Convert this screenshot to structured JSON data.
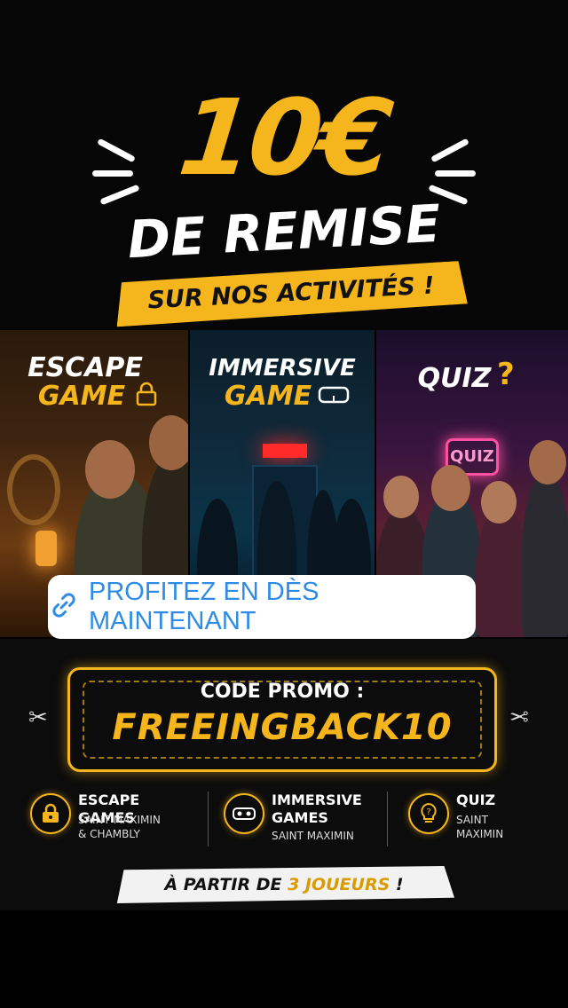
{
  "header": {
    "amount": "10€",
    "headline": "DE REMISE",
    "subline": "SUR NOS ACTIVITÉS !"
  },
  "panels": [
    {
      "line1": "ESCAPE",
      "line2": "GAME",
      "icon": "lock-icon"
    },
    {
      "line1": "IMMERSIVE",
      "line2": "GAME",
      "icon": "vr-headset-icon"
    },
    {
      "title": "QUIZ",
      "icon": "question-mark-icon",
      "sign": "QUIZ"
    }
  ],
  "cta": {
    "label": "PROFITEZ EN DÈS MAINTENANT",
    "icon": "link-icon"
  },
  "promo": {
    "label": "CODE PROMO :",
    "code": "FREEINGBACK10"
  },
  "locations": [
    {
      "title": "ESCAPE GAMES",
      "sub1": "SAINT MAXIMIN",
      "sub2": "& CHAMBLY",
      "icon": "lock-icon"
    },
    {
      "title": "IMMERSIVE",
      "title2": "GAMES",
      "sub1": "SAINT MAXIMIN",
      "icon": "vr-headset-icon"
    },
    {
      "title": "QUIZ",
      "sub1": "SAINT",
      "sub2": "MAXIMIN",
      "icon": "lightbulb-icon"
    }
  ],
  "footer": {
    "prefix": "À PARTIR DE ",
    "highlight": "3 JOUEURS",
    "suffix": " !"
  },
  "colors": {
    "accent": "#f5b51c",
    "link": "#2f8ce6",
    "background": "#000000"
  }
}
